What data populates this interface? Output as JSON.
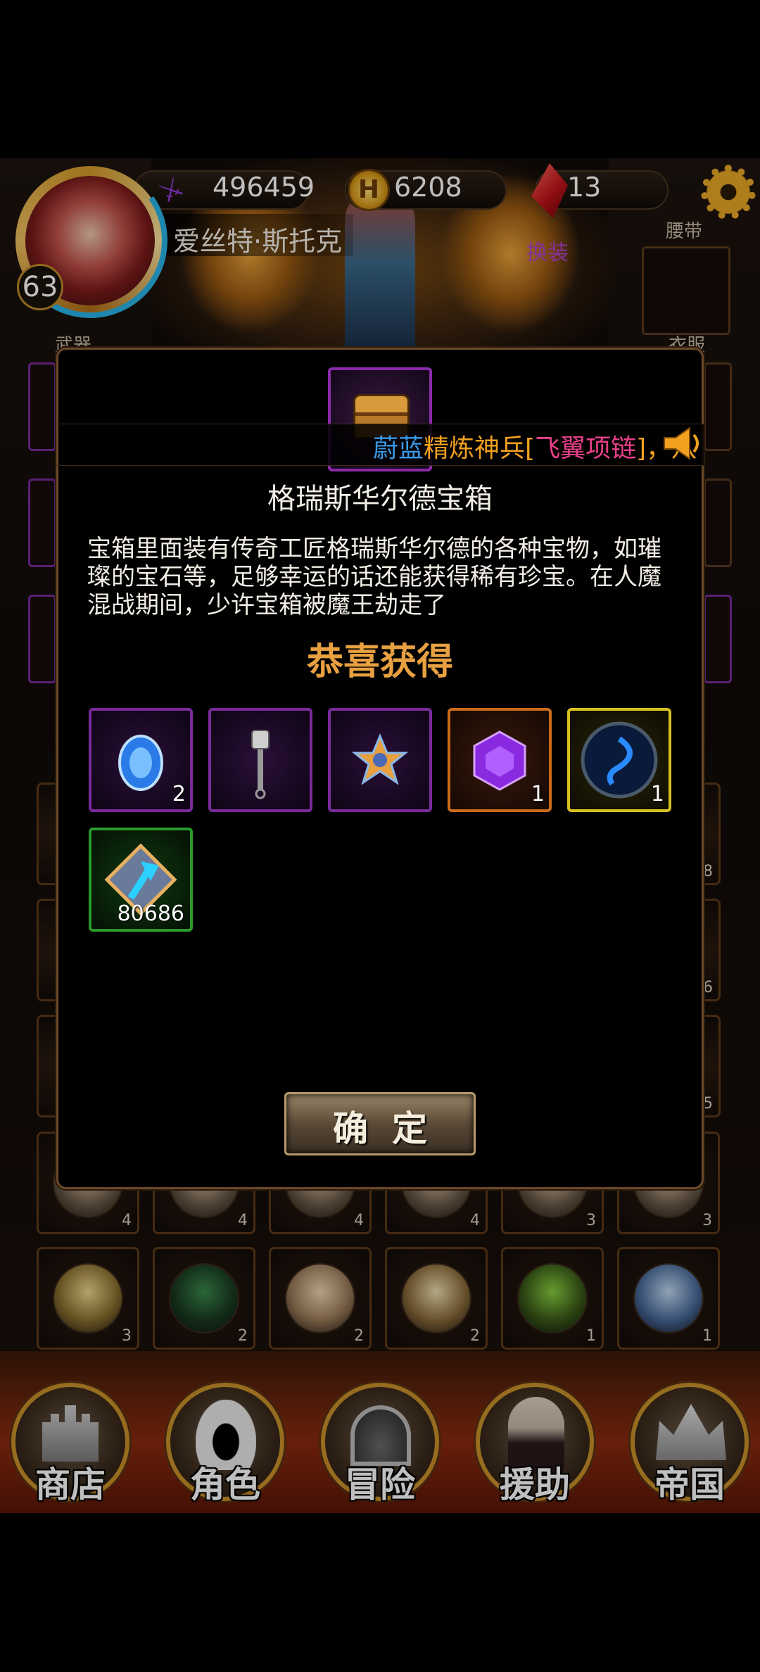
{
  "hud": {
    "level": "63",
    "player_name": "爱丝特·斯托克",
    "power": "496459",
    "gold": "6208",
    "gems": "13",
    "swap_label": "换装",
    "slot_labels": {
      "belt": "腰带",
      "weapon": "武器",
      "clothes": "衣服"
    }
  },
  "marquee": {
    "segments": [
      {
        "text": "蔚蓝",
        "color": "#3a9ae8"
      },
      {
        "text": "精炼神兵[",
        "color": "#f2a020"
      },
      {
        "text": "飞翼项链",
        "color": "#e8408a"
      },
      {
        "text": "]，",
        "color": "#f2a020"
      },
      {
        "text": "八",
        "color": "#f2a020"
      }
    ]
  },
  "modal": {
    "title": "格瑞斯华尔德宝箱",
    "description": "宝箱里面装有传奇工匠格瑞斯华尔德的各种宝物，如璀璨的宝石等，足够幸运的话还能获得稀有珍宝。在人魔混战期间，少许宝箱被魔王劫走了",
    "congrats": "恭喜获得",
    "rewards": [
      {
        "name": "blue-gem",
        "qty": "2",
        "frame": "purple"
      },
      {
        "name": "scepter",
        "qty": "",
        "frame": "purple"
      },
      {
        "name": "star-amulet",
        "qty": "",
        "frame": "purple"
      },
      {
        "name": "purple-crystal",
        "qty": "1",
        "frame": "orange"
      },
      {
        "name": "blue-orb",
        "qty": "1",
        "frame": "gold"
      },
      {
        "name": "exp-arrow",
        "qty": "80686",
        "frame": "green"
      }
    ],
    "confirm_label": "确定"
  },
  "grid_counts": [
    [
      "4",
      "4",
      "4",
      "4",
      "3",
      "3"
    ],
    [
      "3",
      "2",
      "2",
      "2",
      "1",
      "1"
    ]
  ],
  "side_counts": [
    "8",
    "6",
    "5"
  ],
  "nav": [
    {
      "label": "商店",
      "icon": "castle-icon"
    },
    {
      "label": "角色",
      "icon": "hood-icon"
    },
    {
      "label": "冒险",
      "icon": "gate-icon"
    },
    {
      "label": "援助",
      "icon": "helper-icon"
    },
    {
      "label": "帝国",
      "icon": "crown-icon"
    }
  ],
  "colors": {
    "accent": "#e8a040",
    "frame_purple": "#7a2a9a",
    "frame_gold": "#d8c020",
    "frame_green": "#2a9a2a"
  }
}
